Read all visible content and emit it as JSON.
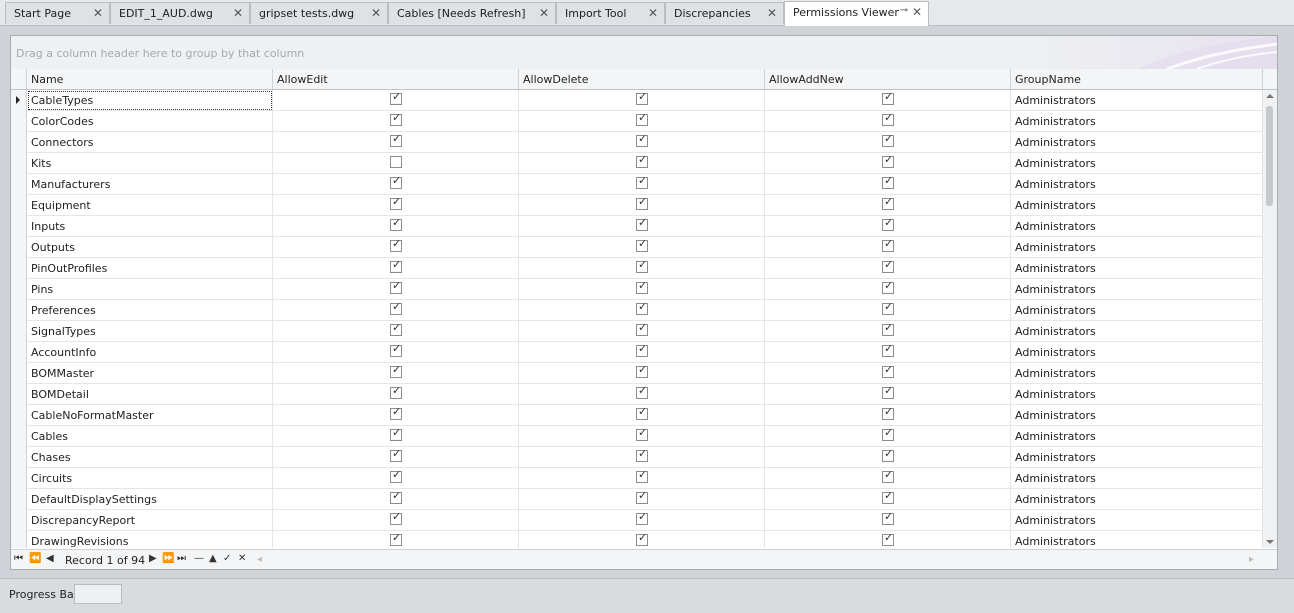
{
  "tabs": [
    {
      "label": "Start Page",
      "close": "✕"
    },
    {
      "label": "EDIT_1_AUD.dwg",
      "close": "✕"
    },
    {
      "label": "gripset tests.dwg",
      "close": "✕"
    },
    {
      "label": "Cables [Needs Refresh]",
      "close": "✕"
    },
    {
      "label": "Import Tool",
      "close": "✕"
    },
    {
      "label": "Discrepancies",
      "close": "✕"
    },
    {
      "label": "Permissions Viewer",
      "close": "✕",
      "pin": "⊸",
      "active": true
    }
  ],
  "grid": {
    "group_hint": "Drag a column header here to group by that column",
    "columns": [
      "Name",
      "AllowEdit",
      "AllowDelete",
      "AllowAddNew",
      "GroupName"
    ],
    "rows": [
      {
        "name": "CableTypes",
        "edit": true,
        "del": true,
        "add": true,
        "group": "Administrators"
      },
      {
        "name": "ColorCodes",
        "edit": true,
        "del": true,
        "add": true,
        "group": "Administrators"
      },
      {
        "name": "Connectors",
        "edit": true,
        "del": true,
        "add": true,
        "group": "Administrators"
      },
      {
        "name": "Kits",
        "edit": false,
        "del": true,
        "add": true,
        "group": "Administrators"
      },
      {
        "name": "Manufacturers",
        "edit": true,
        "del": true,
        "add": true,
        "group": "Administrators"
      },
      {
        "name": "Equipment",
        "edit": true,
        "del": true,
        "add": true,
        "group": "Administrators"
      },
      {
        "name": "Inputs",
        "edit": true,
        "del": true,
        "add": true,
        "group": "Administrators"
      },
      {
        "name": "Outputs",
        "edit": true,
        "del": true,
        "add": true,
        "group": "Administrators"
      },
      {
        "name": "PinOutProfiles",
        "edit": true,
        "del": true,
        "add": true,
        "group": "Administrators"
      },
      {
        "name": "Pins",
        "edit": true,
        "del": true,
        "add": true,
        "group": "Administrators"
      },
      {
        "name": "Preferences",
        "edit": true,
        "del": true,
        "add": true,
        "group": "Administrators"
      },
      {
        "name": "SignalTypes",
        "edit": true,
        "del": true,
        "add": true,
        "group": "Administrators"
      },
      {
        "name": "AccountInfo",
        "edit": true,
        "del": true,
        "add": true,
        "group": "Administrators"
      },
      {
        "name": "BOMMaster",
        "edit": true,
        "del": true,
        "add": true,
        "group": "Administrators"
      },
      {
        "name": "BOMDetail",
        "edit": true,
        "del": true,
        "add": true,
        "group": "Administrators"
      },
      {
        "name": "CableNoFormatMaster",
        "edit": true,
        "del": true,
        "add": true,
        "group": "Administrators"
      },
      {
        "name": "Cables",
        "edit": true,
        "del": true,
        "add": true,
        "group": "Administrators"
      },
      {
        "name": "Chases",
        "edit": true,
        "del": true,
        "add": true,
        "group": "Administrators"
      },
      {
        "name": "Circuits",
        "edit": true,
        "del": true,
        "add": true,
        "group": "Administrators"
      },
      {
        "name": "DefaultDisplaySettings",
        "edit": true,
        "del": true,
        "add": true,
        "group": "Administrators"
      },
      {
        "name": "DiscrepancyReport",
        "edit": true,
        "del": true,
        "add": true,
        "group": "Administrators"
      },
      {
        "name": "DrawingRevisions",
        "edit": true,
        "del": true,
        "add": true,
        "group": "Administrators"
      }
    ]
  },
  "navigator": {
    "record_text": "Record 1 of 94",
    "buttons": [
      "⏮",
      "⏪",
      "◀",
      "▶",
      "⏩",
      "⏭",
      "—",
      "▲",
      "✓",
      "✕"
    ]
  },
  "status": {
    "label": "Progress Bar"
  },
  "icons": {
    "check": "✓"
  }
}
